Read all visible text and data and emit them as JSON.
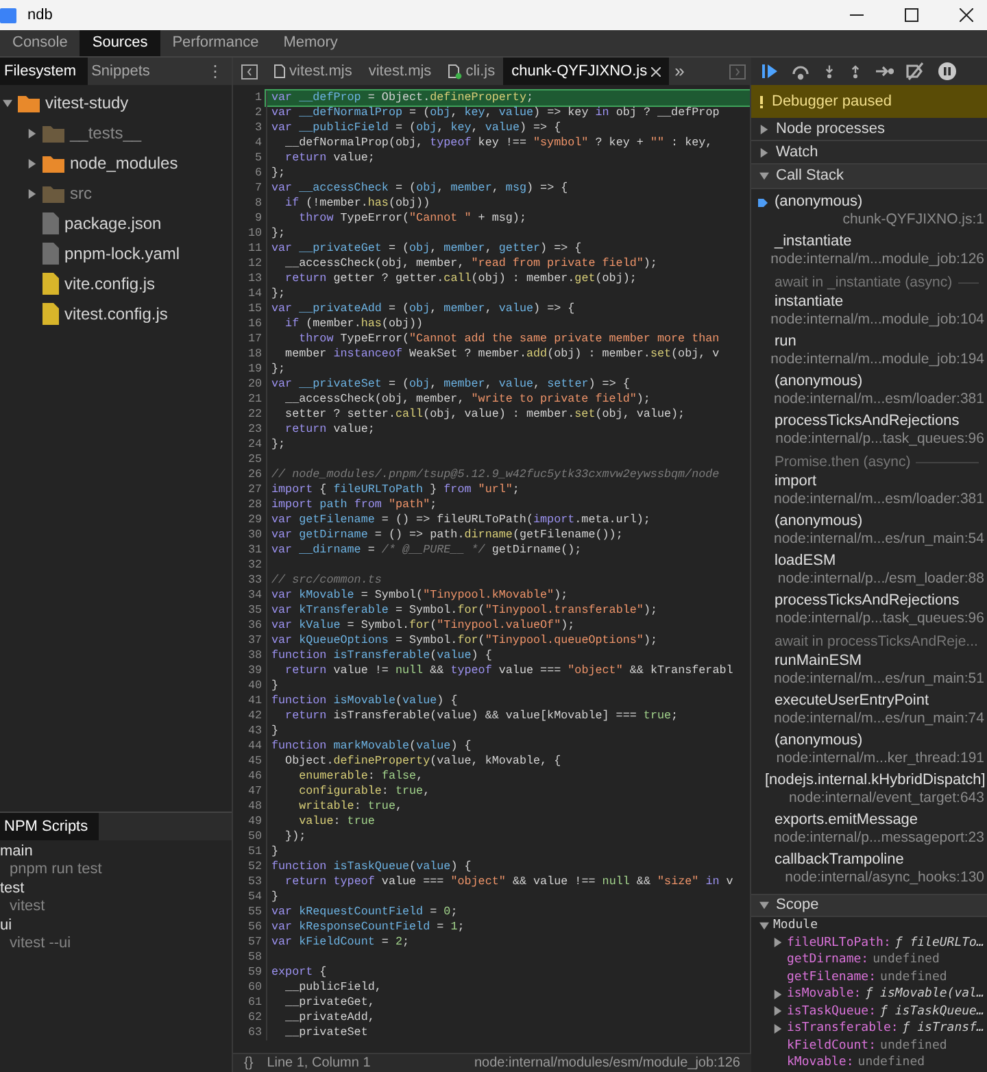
{
  "window": {
    "title": "ndb"
  },
  "main_tabs": [
    {
      "label": "Console",
      "selected": false
    },
    {
      "label": "Sources",
      "selected": true
    },
    {
      "label": "Performance",
      "selected": false
    },
    {
      "label": "Memory",
      "selected": false
    }
  ],
  "navigator": {
    "tabs": [
      {
        "label": "Filesystem",
        "selected": true
      },
      {
        "label": "Snippets",
        "selected": false
      }
    ],
    "more": "⋮",
    "tree": [
      {
        "name": "vitest-study",
        "kind": "folder",
        "expanded": true,
        "dimmed": false,
        "color": "#e8892b",
        "children": [
          {
            "name": "__tests__",
            "kind": "folder",
            "expanded": false,
            "dimmed": true,
            "color": "#6b5a3e"
          },
          {
            "name": "node_modules",
            "kind": "folder",
            "expanded": false,
            "dimmed": false,
            "color": "#e8892b"
          },
          {
            "name": "src",
            "kind": "folder",
            "expanded": false,
            "dimmed": true,
            "color": "#6b5a3e"
          },
          {
            "name": "package.json",
            "kind": "file",
            "dimmed": false,
            "color": "#6e6e6e"
          },
          {
            "name": "pnpm-lock.yaml",
            "kind": "file",
            "dimmed": false,
            "color": "#6e6e6e"
          },
          {
            "name": "vite.config.js",
            "kind": "file",
            "dimmed": false,
            "color": "#d8b52a"
          },
          {
            "name": "vitest.config.js",
            "kind": "file",
            "dimmed": false,
            "color": "#d8b52a"
          }
        ]
      }
    ]
  },
  "npm": {
    "tab": "NPM Scripts",
    "scripts": [
      {
        "name": "main",
        "command": "pnpm run test"
      },
      {
        "name": "test",
        "command": "vitest"
      },
      {
        "name": "ui",
        "command": "vitest --ui"
      }
    ]
  },
  "editor_tabs": [
    {
      "label": "vitest.mjs",
      "kind": "file",
      "selected": false,
      "closable": false
    },
    {
      "label": "vitest.mjs",
      "kind": "plain",
      "selected": false,
      "closable": false
    },
    {
      "label": "cli.js",
      "kind": "linked",
      "selected": false,
      "closable": false
    },
    {
      "label": "chunk-QYFJIXNO.js",
      "kind": "plain",
      "selected": true,
      "closable": true
    }
  ],
  "editor_more": "»",
  "code": [
    {
      "n": "1",
      "current": true,
      "t": [
        {
          "kind": "kw",
          "text": "var"
        },
        {
          "kind": "def",
          "text": " __defProp"
        },
        {
          "kind": "pl",
          "text": " = Object."
        },
        {
          "kind": "prop",
          "text": "defineProperty"
        },
        {
          "kind": "pl",
          "text": ";"
        }
      ]
    },
    {
      "n": "2",
      "current": false,
      "t": [
        {
          "kind": "kw",
          "text": "var"
        },
        {
          "kind": "def",
          "text": " __defNormalProp"
        },
        {
          "kind": "pl",
          "text": " = ("
        },
        {
          "kind": "def",
          "text": "obj"
        },
        {
          "kind": "pl",
          "text": ", "
        },
        {
          "kind": "def",
          "text": "key"
        },
        {
          "kind": "pl",
          "text": ", "
        },
        {
          "kind": "def",
          "text": "value"
        },
        {
          "kind": "pl",
          "text": ") => key"
        },
        {
          "kind": "kw",
          "text": " in"
        },
        {
          "kind": "pl",
          "text": " obj ? __defProp"
        }
      ]
    },
    {
      "n": "3",
      "current": false,
      "t": [
        {
          "kind": "kw",
          "text": "var"
        },
        {
          "kind": "def",
          "text": " __publicField"
        },
        {
          "kind": "pl",
          "text": " = ("
        },
        {
          "kind": "def",
          "text": "obj"
        },
        {
          "kind": "pl",
          "text": ", "
        },
        {
          "kind": "def",
          "text": "key"
        },
        {
          "kind": "pl",
          "text": ", "
        },
        {
          "kind": "def",
          "text": "value"
        },
        {
          "kind": "pl",
          "text": ") => {"
        }
      ]
    },
    {
      "n": "4",
      "current": false,
      "t": [
        {
          "kind": "pl",
          "text": "  __defNormalProp(obj, "
        },
        {
          "kind": "kw",
          "text": "typeof"
        },
        {
          "kind": "pl",
          "text": " key !== "
        },
        {
          "kind": "str",
          "text": "\"symbol\""
        },
        {
          "kind": "pl",
          "text": " ? key + "
        },
        {
          "kind": "str",
          "text": "\"\""
        },
        {
          "kind": "pl",
          "text": " : key,"
        }
      ]
    },
    {
      "n": "5",
      "current": false,
      "t": [
        {
          "kind": "kw",
          "text": "  return"
        },
        {
          "kind": "pl",
          "text": " value;"
        }
      ]
    },
    {
      "n": "6",
      "current": false,
      "t": [
        {
          "kind": "pl",
          "text": "};"
        }
      ]
    },
    {
      "n": "7",
      "current": false,
      "t": [
        {
          "kind": "kw",
          "text": "var"
        },
        {
          "kind": "def",
          "text": " __accessCheck"
        },
        {
          "kind": "pl",
          "text": " = ("
        },
        {
          "kind": "def",
          "text": "obj"
        },
        {
          "kind": "pl",
          "text": ", "
        },
        {
          "kind": "def",
          "text": "member"
        },
        {
          "kind": "pl",
          "text": ", "
        },
        {
          "kind": "def",
          "text": "msg"
        },
        {
          "kind": "pl",
          "text": ") => {"
        }
      ]
    },
    {
      "n": "8",
      "current": false,
      "t": [
        {
          "kind": "kw",
          "text": "  if"
        },
        {
          "kind": "pl",
          "text": " (!member."
        },
        {
          "kind": "prop",
          "text": "has"
        },
        {
          "kind": "pl",
          "text": "(obj))"
        }
      ]
    },
    {
      "n": "9",
      "current": false,
      "t": [
        {
          "kind": "kw",
          "text": "    throw"
        },
        {
          "kind": "pl",
          "text": " TypeError("
        },
        {
          "kind": "str",
          "text": "\"Cannot \""
        },
        {
          "kind": "pl",
          "text": " + msg);"
        }
      ]
    },
    {
      "n": "10",
      "current": false,
      "t": [
        {
          "kind": "pl",
          "text": "};"
        }
      ]
    },
    {
      "n": "11",
      "current": false,
      "t": [
        {
          "kind": "kw",
          "text": "var"
        },
        {
          "kind": "def",
          "text": " __privateGet"
        },
        {
          "kind": "pl",
          "text": " = ("
        },
        {
          "kind": "def",
          "text": "obj"
        },
        {
          "kind": "pl",
          "text": ", "
        },
        {
          "kind": "def",
          "text": "member"
        },
        {
          "kind": "pl",
          "text": ", "
        },
        {
          "kind": "def",
          "text": "getter"
        },
        {
          "kind": "pl",
          "text": ") => {"
        }
      ]
    },
    {
      "n": "12",
      "current": false,
      "t": [
        {
          "kind": "pl",
          "text": "  __accessCheck(obj, member, "
        },
        {
          "kind": "str",
          "text": "\"read from private field\""
        },
        {
          "kind": "pl",
          "text": ");"
        }
      ]
    },
    {
      "n": "13",
      "current": false,
      "t": [
        {
          "kind": "kw",
          "text": "  return"
        },
        {
          "kind": "pl",
          "text": " getter ? getter."
        },
        {
          "kind": "prop",
          "text": "call"
        },
        {
          "kind": "pl",
          "text": "(obj) : member."
        },
        {
          "kind": "prop",
          "text": "get"
        },
        {
          "kind": "pl",
          "text": "(obj);"
        }
      ]
    },
    {
      "n": "14",
      "current": false,
      "t": [
        {
          "kind": "pl",
          "text": "};"
        }
      ]
    },
    {
      "n": "15",
      "current": false,
      "t": [
        {
          "kind": "kw",
          "text": "var"
        },
        {
          "kind": "def",
          "text": " __privateAdd"
        },
        {
          "kind": "pl",
          "text": " = ("
        },
        {
          "kind": "def",
          "text": "obj"
        },
        {
          "kind": "pl",
          "text": ", "
        },
        {
          "kind": "def",
          "text": "member"
        },
        {
          "kind": "pl",
          "text": ", "
        },
        {
          "kind": "def",
          "text": "value"
        },
        {
          "kind": "pl",
          "text": ") => {"
        }
      ]
    },
    {
      "n": "16",
      "current": false,
      "t": [
        {
          "kind": "kw",
          "text": "  if"
        },
        {
          "kind": "pl",
          "text": " (member."
        },
        {
          "kind": "prop",
          "text": "has"
        },
        {
          "kind": "pl",
          "text": "(obj))"
        }
      ]
    },
    {
      "n": "17",
      "current": false,
      "t": [
        {
          "kind": "kw",
          "text": "    throw"
        },
        {
          "kind": "pl",
          "text": " TypeError("
        },
        {
          "kind": "str",
          "text": "\"Cannot add the same private member more than"
        }
      ]
    },
    {
      "n": "18",
      "current": false,
      "t": [
        {
          "kind": "pl",
          "text": "  member"
        },
        {
          "kind": "kw",
          "text": " instanceof"
        },
        {
          "kind": "pl",
          "text": " WeakSet ? member."
        },
        {
          "kind": "prop",
          "text": "add"
        },
        {
          "kind": "pl",
          "text": "(obj) : member."
        },
        {
          "kind": "prop",
          "text": "set"
        },
        {
          "kind": "pl",
          "text": "(obj, v"
        }
      ]
    },
    {
      "n": "19",
      "current": false,
      "t": [
        {
          "kind": "pl",
          "text": "};"
        }
      ]
    },
    {
      "n": "20",
      "current": false,
      "t": [
        {
          "kind": "kw",
          "text": "var"
        },
        {
          "kind": "def",
          "text": " __privateSet"
        },
        {
          "kind": "pl",
          "text": " = ("
        },
        {
          "kind": "def",
          "text": "obj"
        },
        {
          "kind": "pl",
          "text": ", "
        },
        {
          "kind": "def",
          "text": "member"
        },
        {
          "kind": "pl",
          "text": ", "
        },
        {
          "kind": "def",
          "text": "value"
        },
        {
          "kind": "pl",
          "text": ", "
        },
        {
          "kind": "def",
          "text": "setter"
        },
        {
          "kind": "pl",
          "text": ") => {"
        }
      ]
    },
    {
      "n": "21",
      "current": false,
      "t": [
        {
          "kind": "pl",
          "text": "  __accessCheck(obj, member, "
        },
        {
          "kind": "str",
          "text": "\"write to private field\""
        },
        {
          "kind": "pl",
          "text": ");"
        }
      ]
    },
    {
      "n": "22",
      "current": false,
      "t": [
        {
          "kind": "pl",
          "text": "  setter ? setter."
        },
        {
          "kind": "prop",
          "text": "call"
        },
        {
          "kind": "pl",
          "text": "(obj, value) : member."
        },
        {
          "kind": "prop",
          "text": "set"
        },
        {
          "kind": "pl",
          "text": "(obj, value);"
        }
      ]
    },
    {
      "n": "23",
      "current": false,
      "t": [
        {
          "kind": "kw",
          "text": "  return"
        },
        {
          "kind": "pl",
          "text": " value;"
        }
      ]
    },
    {
      "n": "24",
      "current": false,
      "t": [
        {
          "kind": "pl",
          "text": "};"
        }
      ]
    },
    {
      "n": "25",
      "current": false
    },
    {
      "n": "26",
      "current": false,
      "t": [
        {
          "kind": "com",
          "text": "// node_modules/.pnpm/tsup@5.12.9_w42fuc5ytk33cxmvw2eywssbqm/node"
        }
      ]
    },
    {
      "n": "27",
      "current": false,
      "t": [
        {
          "kind": "kw",
          "text": "import"
        },
        {
          "kind": "pl",
          "text": " { "
        },
        {
          "kind": "def",
          "text": "fileURLToPath"
        },
        {
          "kind": "pl",
          "text": " } "
        },
        {
          "kind": "kw",
          "text": "from"
        },
        {
          "kind": "str",
          "text": " \"url\""
        },
        {
          "kind": "pl",
          "text": ";"
        }
      ]
    },
    {
      "n": "28",
      "current": false,
      "t": [
        {
          "kind": "kw",
          "text": "import"
        },
        {
          "kind": "def",
          "text": " path"
        },
        {
          "kind": "kw",
          "text": " from"
        },
        {
          "kind": "str",
          "text": " \"path\""
        },
        {
          "kind": "pl",
          "text": ";"
        }
      ]
    },
    {
      "n": "29",
      "current": false,
      "t": [
        {
          "kind": "kw",
          "text": "var"
        },
        {
          "kind": "def",
          "text": " getFilename"
        },
        {
          "kind": "pl",
          "text": " = () => fileURLToPath("
        },
        {
          "kind": "kw",
          "text": "import"
        },
        {
          "kind": "pl",
          "text": ".meta.url);"
        }
      ]
    },
    {
      "n": "30",
      "current": false,
      "t": [
        {
          "kind": "kw",
          "text": "var"
        },
        {
          "kind": "def",
          "text": " getDirname"
        },
        {
          "kind": "pl",
          "text": " = () => path."
        },
        {
          "kind": "prop",
          "text": "dirname"
        },
        {
          "kind": "pl",
          "text": "(getFilename());"
        }
      ]
    },
    {
      "n": "31",
      "current": false,
      "t": [
        {
          "kind": "kw",
          "text": "var"
        },
        {
          "kind": "def",
          "text": " __dirname"
        },
        {
          "kind": "pl",
          "text": " = "
        },
        {
          "kind": "com",
          "text": "/* @__PURE__ */"
        },
        {
          "kind": "pl",
          "text": " getDirname();"
        }
      ]
    },
    {
      "n": "32",
      "current": false
    },
    {
      "n": "33",
      "current": false,
      "t": [
        {
          "kind": "com",
          "text": "// src/common.ts"
        }
      ]
    },
    {
      "n": "34",
      "current": false,
      "t": [
        {
          "kind": "kw",
          "text": "var"
        },
        {
          "kind": "def",
          "text": " kMovable"
        },
        {
          "kind": "pl",
          "text": " = Symbol("
        },
        {
          "kind": "str",
          "text": "\"Tinypool.kMovable\""
        },
        {
          "kind": "pl",
          "text": ");"
        }
      ]
    },
    {
      "n": "35",
      "current": false,
      "t": [
        {
          "kind": "kw",
          "text": "var"
        },
        {
          "kind": "def",
          "text": " kTransferable"
        },
        {
          "kind": "pl",
          "text": " = Symbol."
        },
        {
          "kind": "prop",
          "text": "for"
        },
        {
          "kind": "pl",
          "text": "("
        },
        {
          "kind": "str",
          "text": "\"Tinypool.transferable\""
        },
        {
          "kind": "pl",
          "text": ");"
        }
      ]
    },
    {
      "n": "36",
      "current": false,
      "t": [
        {
          "kind": "kw",
          "text": "var"
        },
        {
          "kind": "def",
          "text": " kValue"
        },
        {
          "kind": "pl",
          "text": " = Symbol."
        },
        {
          "kind": "prop",
          "text": "for"
        },
        {
          "kind": "pl",
          "text": "("
        },
        {
          "kind": "str",
          "text": "\"Tinypool.valueOf\""
        },
        {
          "kind": "pl",
          "text": ");"
        }
      ]
    },
    {
      "n": "37",
      "current": false,
      "t": [
        {
          "kind": "kw",
          "text": "var"
        },
        {
          "kind": "def",
          "text": " kQueueOptions"
        },
        {
          "kind": "pl",
          "text": " = Symbol."
        },
        {
          "kind": "prop",
          "text": "for"
        },
        {
          "kind": "pl",
          "text": "("
        },
        {
          "kind": "str",
          "text": "\"Tinypool.queueOptions\""
        },
        {
          "kind": "pl",
          "text": ");"
        }
      ]
    },
    {
      "n": "38",
      "current": false,
      "t": [
        {
          "kind": "kw",
          "text": "function"
        },
        {
          "kind": "def",
          "text": " isTransferable"
        },
        {
          "kind": "pl",
          "text": "("
        },
        {
          "kind": "def",
          "text": "value"
        },
        {
          "kind": "pl",
          "text": ") {"
        }
      ]
    },
    {
      "n": "39",
      "current": false,
      "t": [
        {
          "kind": "kw",
          "text": "  return"
        },
        {
          "kind": "pl",
          "text": " value != "
        },
        {
          "kind": "lit",
          "text": "null"
        },
        {
          "kind": "pl",
          "text": " && "
        },
        {
          "kind": "kw",
          "text": "typeof"
        },
        {
          "kind": "pl",
          "text": " value === "
        },
        {
          "kind": "str",
          "text": "\"object\""
        },
        {
          "kind": "pl",
          "text": " && kTransferabl"
        }
      ]
    },
    {
      "n": "40",
      "current": false,
      "t": [
        {
          "kind": "pl",
          "text": "}"
        }
      ]
    },
    {
      "n": "41",
      "current": false,
      "t": [
        {
          "kind": "kw",
          "text": "function"
        },
        {
          "kind": "def",
          "text": " isMovable"
        },
        {
          "kind": "pl",
          "text": "("
        },
        {
          "kind": "def",
          "text": "value"
        },
        {
          "kind": "pl",
          "text": ") {"
        }
      ]
    },
    {
      "n": "42",
      "current": false,
      "t": [
        {
          "kind": "kw",
          "text": "  return"
        },
        {
          "kind": "pl",
          "text": " isTransferable(value) && value[kMovable] === "
        },
        {
          "kind": "lit",
          "text": "true"
        },
        {
          "kind": "pl",
          "text": ";"
        }
      ]
    },
    {
      "n": "43",
      "current": false,
      "t": [
        {
          "kind": "pl",
          "text": "}"
        }
      ]
    },
    {
      "n": "44",
      "current": false,
      "t": [
        {
          "kind": "kw",
          "text": "function"
        },
        {
          "kind": "def",
          "text": " markMovable"
        },
        {
          "kind": "pl",
          "text": "("
        },
        {
          "kind": "def",
          "text": "value"
        },
        {
          "kind": "pl",
          "text": ") {"
        }
      ]
    },
    {
      "n": "45",
      "current": false,
      "t": [
        {
          "kind": "pl",
          "text": "  Object."
        },
        {
          "kind": "prop",
          "text": "defineProperty"
        },
        {
          "kind": "pl",
          "text": "(value, kMovable, {"
        }
      ]
    },
    {
      "n": "46",
      "current": false,
      "t": [
        {
          "kind": "prop",
          "text": "    enumerable"
        },
        {
          "kind": "pl",
          "text": ": "
        },
        {
          "kind": "lit",
          "text": "false"
        },
        {
          "kind": "pl",
          "text": ","
        }
      ]
    },
    {
      "n": "47",
      "current": false,
      "t": [
        {
          "kind": "prop",
          "text": "    configurable"
        },
        {
          "kind": "pl",
          "text": ": "
        },
        {
          "kind": "lit",
          "text": "true"
        },
        {
          "kind": "pl",
          "text": ","
        }
      ]
    },
    {
      "n": "48",
      "current": false,
      "t": [
        {
          "kind": "prop",
          "text": "    writable"
        },
        {
          "kind": "pl",
          "text": ": "
        },
        {
          "kind": "lit",
          "text": "true"
        },
        {
          "kind": "pl",
          "text": ","
        }
      ]
    },
    {
      "n": "49",
      "current": false,
      "t": [
        {
          "kind": "prop",
          "text": "    value"
        },
        {
          "kind": "pl",
          "text": ": "
        },
        {
          "kind": "lit",
          "text": "true"
        }
      ]
    },
    {
      "n": "50",
      "current": false,
      "t": [
        {
          "kind": "pl",
          "text": "  });"
        }
      ]
    },
    {
      "n": "51",
      "current": false,
      "t": [
        {
          "kind": "pl",
          "text": "}"
        }
      ]
    },
    {
      "n": "52",
      "current": false,
      "t": [
        {
          "kind": "kw",
          "text": "function"
        },
        {
          "kind": "def",
          "text": " isTaskQueue"
        },
        {
          "kind": "pl",
          "text": "("
        },
        {
          "kind": "def",
          "text": "value"
        },
        {
          "kind": "pl",
          "text": ") {"
        }
      ]
    },
    {
      "n": "53",
      "current": false,
      "t": [
        {
          "kind": "kw",
          "text": "  return"
        },
        {
          "kind": "kw",
          "text": " typeof"
        },
        {
          "kind": "pl",
          "text": " value === "
        },
        {
          "kind": "str",
          "text": "\"object\""
        },
        {
          "kind": "pl",
          "text": " && value !== "
        },
        {
          "kind": "lit",
          "text": "null"
        },
        {
          "kind": "pl",
          "text": " && "
        },
        {
          "kind": "str",
          "text": "\"size\""
        },
        {
          "kind": "kw",
          "text": " in"
        },
        {
          "kind": "pl",
          "text": " v"
        }
      ]
    },
    {
      "n": "54",
      "current": false,
      "t": [
        {
          "kind": "pl",
          "text": "}"
        }
      ]
    },
    {
      "n": "55",
      "current": false,
      "t": [
        {
          "kind": "kw",
          "text": "var"
        },
        {
          "kind": "def",
          "text": " kRequestCountField"
        },
        {
          "kind": "pl",
          "text": " = "
        },
        {
          "kind": "lit",
          "text": "0"
        },
        {
          "kind": "pl",
          "text": ";"
        }
      ]
    },
    {
      "n": "56",
      "current": false,
      "t": [
        {
          "kind": "kw",
          "text": "var"
        },
        {
          "kind": "def",
          "text": " kResponseCountField"
        },
        {
          "kind": "pl",
          "text": " = "
        },
        {
          "kind": "lit",
          "text": "1"
        },
        {
          "kind": "pl",
          "text": ";"
        }
      ]
    },
    {
      "n": "57",
      "current": false,
      "t": [
        {
          "kind": "kw",
          "text": "var"
        },
        {
          "kind": "def",
          "text": " kFieldCount"
        },
        {
          "kind": "pl",
          "text": " = "
        },
        {
          "kind": "lit",
          "text": "2"
        },
        {
          "kind": "pl",
          "text": ";"
        }
      ]
    },
    {
      "n": "58",
      "current": false
    },
    {
      "n": "59",
      "current": false,
      "t": [
        {
          "kind": "kw",
          "text": "export"
        },
        {
          "kind": "pl",
          "text": " {"
        }
      ]
    },
    {
      "n": "60",
      "current": false,
      "t": [
        {
          "kind": "pl",
          "text": "  __publicField,"
        }
      ]
    },
    {
      "n": "61",
      "current": false,
      "t": [
        {
          "kind": "pl",
          "text": "  __privateGet,"
        }
      ]
    },
    {
      "n": "62",
      "current": false,
      "t": [
        {
          "kind": "pl",
          "text": "  __privateAdd,"
        }
      ]
    },
    {
      "n": "63",
      "current": false,
      "t": [
        {
          "kind": "pl",
          "text": "  __privateSet"
        }
      ]
    }
  ],
  "status_bar": {
    "format": "{}",
    "position": "Line 1, Column 1",
    "location": "node:internal/modules/esm/module_job:126"
  },
  "debugger": {
    "banner": "Debugger paused",
    "sections": [
      {
        "title": "Node processes",
        "expanded": false
      },
      {
        "title": "Watch",
        "expanded": false
      }
    ],
    "call_stack": {
      "title": "Call Stack",
      "expanded": true,
      "frames": [
        {
          "kind": "frame",
          "name": "(anonymous)",
          "location": "chunk-QYFJIXNO.js:1",
          "selected": true
        },
        {
          "kind": "frame",
          "name": "_instantiate",
          "location": "node:internal/m...module_job:126",
          "selected": false
        },
        {
          "kind": "async",
          "name": "await in _instantiate (async)"
        },
        {
          "kind": "frame",
          "name": "instantiate",
          "location": "node:internal/m...module_job:104",
          "selected": false
        },
        {
          "kind": "frame",
          "name": "run",
          "location": "node:internal/m...module_job:194",
          "selected": false
        },
        {
          "kind": "frame",
          "name": "(anonymous)",
          "location": "node:internal/m...esm/loader:381",
          "selected": false
        },
        {
          "kind": "frame",
          "name": "processTicksAndRejections",
          "location": "node:internal/p...task_queues:96",
          "selected": false
        },
        {
          "kind": "async",
          "name": "Promise.then (async)"
        },
        {
          "kind": "frame",
          "name": "import",
          "location": "node:internal/m...esm/loader:381",
          "selected": false
        },
        {
          "kind": "frame",
          "name": "(anonymous)",
          "location": "node:internal/m...es/run_main:54",
          "selected": false
        },
        {
          "kind": "frame",
          "name": "loadESM",
          "location": "node:internal/p.../esm_loader:88",
          "selected": false
        },
        {
          "kind": "frame",
          "name": "processTicksAndRejections",
          "location": "node:internal/p...task_queues:96",
          "selected": false
        },
        {
          "kind": "async",
          "name": "await in processTicksAndReje..."
        },
        {
          "kind": "frame",
          "name": "runMainESM",
          "location": "node:internal/m...es/run_main:51",
          "selected": false
        },
        {
          "kind": "frame",
          "name": "executeUserEntryPoint",
          "location": "node:internal/m...es/run_main:74",
          "selected": false
        },
        {
          "kind": "frame",
          "name": "(anonymous)",
          "location": "node:internal/m...ker_thread:191",
          "selected": false
        },
        {
          "kind": "frame",
          "name": "[nodejs.internal.kHybridDispatch]",
          "location": "node:internal/event_target:643",
          "selected": false
        },
        {
          "kind": "frame",
          "name": "exports.emitMessage",
          "location": "node:internal/p...messageport:23",
          "selected": false
        },
        {
          "kind": "frame",
          "name": "callbackTrampoline",
          "location": "node:internal/async_hooks:130",
          "selected": false
        }
      ]
    },
    "scope": {
      "title": "Scope",
      "expanded": true,
      "groups": [
        {
          "name": "Module",
          "expanded": true,
          "vars": [
            {
              "name": "fileURLToPath:",
              "kind": "function",
              "value": "ƒ fileURLTo…",
              "expanded": false
            },
            {
              "name": "getDirname:",
              "kind": "plain",
              "value": "undefined"
            },
            {
              "name": "getFilename:",
              "kind": "plain",
              "value": "undefined"
            },
            {
              "name": "isMovable:",
              "kind": "function",
              "value": "ƒ isMovable(val…",
              "expanded": false
            },
            {
              "name": "isTaskQueue:",
              "kind": "function",
              "value": "ƒ isTaskQueue…",
              "expanded": false
            },
            {
              "name": "isTransferable:",
              "kind": "function",
              "value": "ƒ isTransf…",
              "expanded": false
            },
            {
              "name": "kFieldCount:",
              "kind": "plain",
              "value": "undefined"
            },
            {
              "name": "kMovable:",
              "kind": "plain",
              "value": "undefined"
            }
          ]
        }
      ]
    }
  }
}
